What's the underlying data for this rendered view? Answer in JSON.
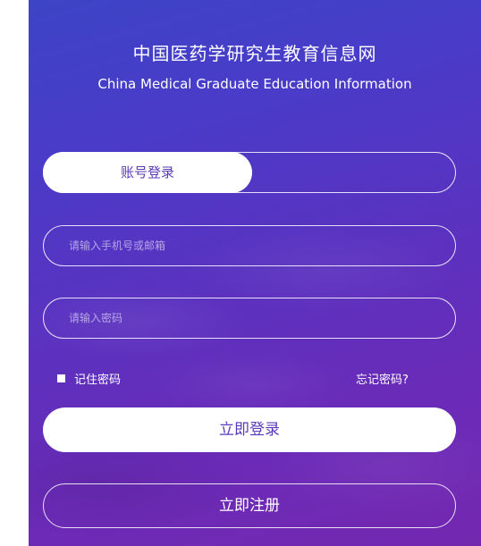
{
  "header": {
    "title_cn": "中国医药学研究生教育信息网",
    "title_en": "China Medical Graduate Education Information"
  },
  "tabs": [
    {
      "label": "账号登录",
      "active": true
    }
  ],
  "form": {
    "account_placeholder": "请输入手机号或邮箱",
    "account_value": "",
    "password_placeholder": "请输入密码",
    "password_value": "",
    "remember_label": "记住密码",
    "remember_checked": false,
    "forgot_label": "忘记密码?"
  },
  "actions": {
    "login_label": "立即登录",
    "register_label": "立即注册"
  },
  "colors": {
    "gradient_start": "#3d44c6",
    "gradient_end": "#7428b0",
    "accent_text": "#5a3ab8"
  }
}
